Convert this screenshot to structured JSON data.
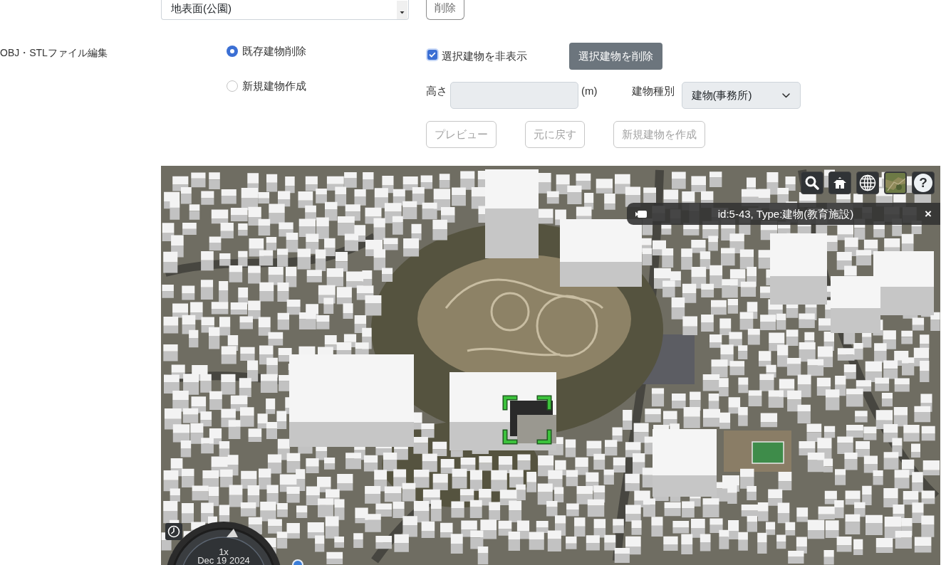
{
  "ground_surface": {
    "select": {
      "value": "地表面(公園)"
    },
    "delete_button": {
      "label": "削除"
    }
  },
  "obj_stl_edit": {
    "label": "OBJ・STLファイル編集",
    "modes": [
      {
        "label": "既存建物削除",
        "selected": true
      },
      {
        "label": "新規建物作成",
        "selected": false
      }
    ],
    "hide_selected": {
      "label": "選択建物を非表示",
      "checked": true
    },
    "delete_selected_button": {
      "label": "選択建物を削除"
    },
    "height": {
      "label": "高さ",
      "unit": "(m)",
      "disabled": true
    },
    "building_type": {
      "label": "建物種別",
      "value": "建物(事務所)",
      "disabled": true
    },
    "actions": [
      {
        "label": "プレビュー",
        "disabled": true
      },
      {
        "label": "元に戻す",
        "disabled": true
      },
      {
        "label": "新規建物を作成",
        "disabled": true
      }
    ]
  },
  "map": {
    "toolbar": [
      {
        "kind": "search"
      },
      {
        "kind": "home"
      },
      {
        "kind": "globe"
      },
      {
        "kind": "imagery"
      },
      {
        "kind": "help",
        "label": "?"
      }
    ],
    "info_box": {
      "title": "id:5-43, Type:建物(教育施設)",
      "close": "×"
    },
    "animation": {
      "speed": "1x",
      "date": "Dec 19 2024"
    }
  }
}
